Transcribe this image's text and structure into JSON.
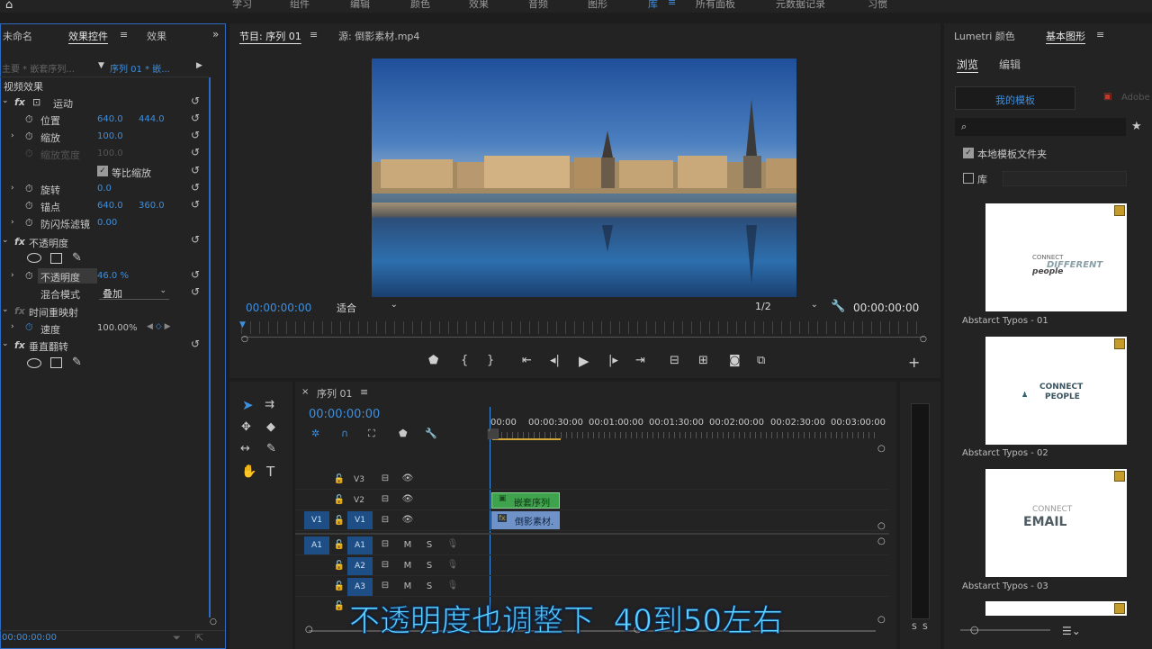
{
  "workspaces": [
    "学习",
    "组件",
    "编辑",
    "颜色",
    "效果",
    "音频",
    "图形",
    "库",
    "所有面板",
    "元数据记录",
    "习惯"
  ],
  "workspace_active": "库",
  "left_panel": {
    "tabs": [
      "未命名",
      "效果控件",
      "效果"
    ],
    "active_tab": "效果控件",
    "source_label": "主要 * 嵌套序列...",
    "sequence_label": "序列 01 * 嵌...",
    "section_video": "视频效果",
    "motion": "运动",
    "position_label": "位置",
    "position_x": "640.0",
    "position_y": "444.0",
    "scale_label": "缩放",
    "scale_value": "100.0",
    "scale_width_label": "缩放宽度",
    "scale_width_value": "100.0",
    "uniform_scale_label": "等比缩放",
    "rotation_label": "旋转",
    "rotation_value": "0.0",
    "anchor_label": "锚点",
    "anchor_x": "640.0",
    "anchor_y": "360.0",
    "flicker_label": "防闪烁滤镜",
    "flicker_value": "0.00",
    "opacity_section": "不透明度",
    "opacity_label": "不透明度",
    "opacity_value": "46.0 %",
    "blend_label": "混合模式",
    "blend_value": "叠加",
    "time_remap": "时间重映射",
    "speed_label": "速度",
    "speed_value": "100.00%",
    "vflip": "垂直翻转",
    "bottom_timecode": "00:00:00:00"
  },
  "program": {
    "tab_program": "节目: 序列 01",
    "tab_source": "源: 倒影素材.mp4",
    "timecode": "00:00:00:00",
    "fit": "适合",
    "quality": "1/2",
    "duration": "00:00:00:00"
  },
  "timeline": {
    "tab": "序列 01",
    "timecode": "00:00:00:00",
    "ruler": [
      "00:00",
      "00:00:30:00",
      "00:01:00:00",
      "00:01:30:00",
      "00:02:00:00",
      "00:02:30:00",
      "00:03:00:00"
    ],
    "tracks": [
      {
        "src": "",
        "name": "V3"
      },
      {
        "src": "",
        "name": "V2"
      },
      {
        "src": "V1",
        "name": "V1"
      },
      {
        "src": "A1",
        "name": "A1"
      },
      {
        "src": "",
        "name": "A2"
      },
      {
        "src": "",
        "name": "A3"
      }
    ],
    "clip_v2": "嵌套序列",
    "clip_v1": "倒影素材.",
    "mute": "M",
    "solo": "S"
  },
  "right_panel": {
    "tabs": [
      "Lumetri 颜色",
      "基本图形"
    ],
    "active_tab": "基本图形",
    "subtabs": [
      "浏览",
      "编辑"
    ],
    "active_subtab": "浏览",
    "my_templates": "我的模板",
    "adobe": "Adobe",
    "local_folder": "本地模板文件夹",
    "library": "库",
    "templates": [
      "Abstarct Typos - 01",
      "Abstarct Typos - 02",
      "Abstarct Typos - 03"
    ],
    "thumb_text": {
      "t1_a": "CONNECT",
      "t1_b": "DIFFERENT",
      "t1_c": "people",
      "t2_a": "CONNECT",
      "t2_b": "PEOPLE",
      "t3_a": "CONNECT",
      "t3_b": "EMAIL"
    }
  },
  "audio_meter": {
    "solo_left": "S",
    "solo_right": "S"
  },
  "subtitle": "不透明度也调整下  40到50左右",
  "colors": {
    "accent": "#3d8fe0",
    "clip_green": "#3fa34d",
    "clip_blue": "#6f93c8",
    "subtitle": "#5fd2ff"
  }
}
